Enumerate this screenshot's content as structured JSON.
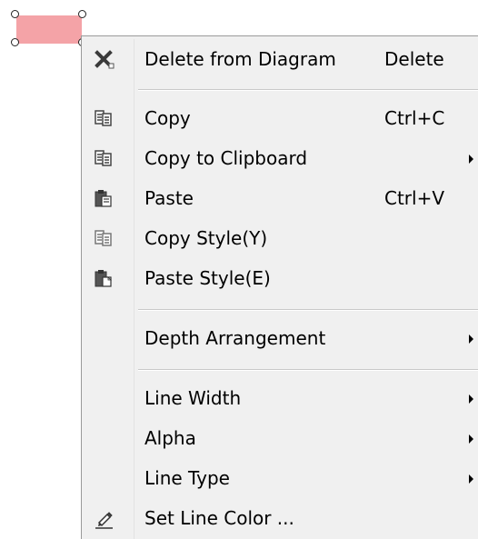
{
  "menu": {
    "items": [
      {
        "label": "Delete from Diagram",
        "shortcut": "Delete",
        "icon": "delete-x-icon",
        "submenu": false
      },
      {
        "label": "Copy",
        "shortcut": "Ctrl+C",
        "icon": "copy-icon",
        "submenu": false
      },
      {
        "label": "Copy to Clipboard",
        "shortcut": "",
        "icon": "copy-icon",
        "submenu": true
      },
      {
        "label": "Paste",
        "shortcut": "Ctrl+V",
        "icon": "paste-icon",
        "submenu": false
      },
      {
        "label": "Copy Style(Y)",
        "shortcut": "",
        "icon": "copy-style-icon",
        "submenu": false
      },
      {
        "label": "Paste Style(E)",
        "shortcut": "",
        "icon": "paste-style-icon",
        "submenu": false
      },
      {
        "label": "Depth Arrangement",
        "shortcut": "",
        "icon": "",
        "submenu": true
      },
      {
        "label": "Line Width",
        "shortcut": "",
        "icon": "",
        "submenu": true
      },
      {
        "label": "Alpha",
        "shortcut": "",
        "icon": "",
        "submenu": true
      },
      {
        "label": "Line Type",
        "shortcut": "",
        "icon": "",
        "submenu": true
      },
      {
        "label": "Set Line Color ...",
        "shortcut": "",
        "icon": "pen-icon",
        "submenu": false
      }
    ]
  },
  "colors": {
    "shape_fill": "#f4a3a7",
    "menu_bg": "#f0f0f0"
  }
}
